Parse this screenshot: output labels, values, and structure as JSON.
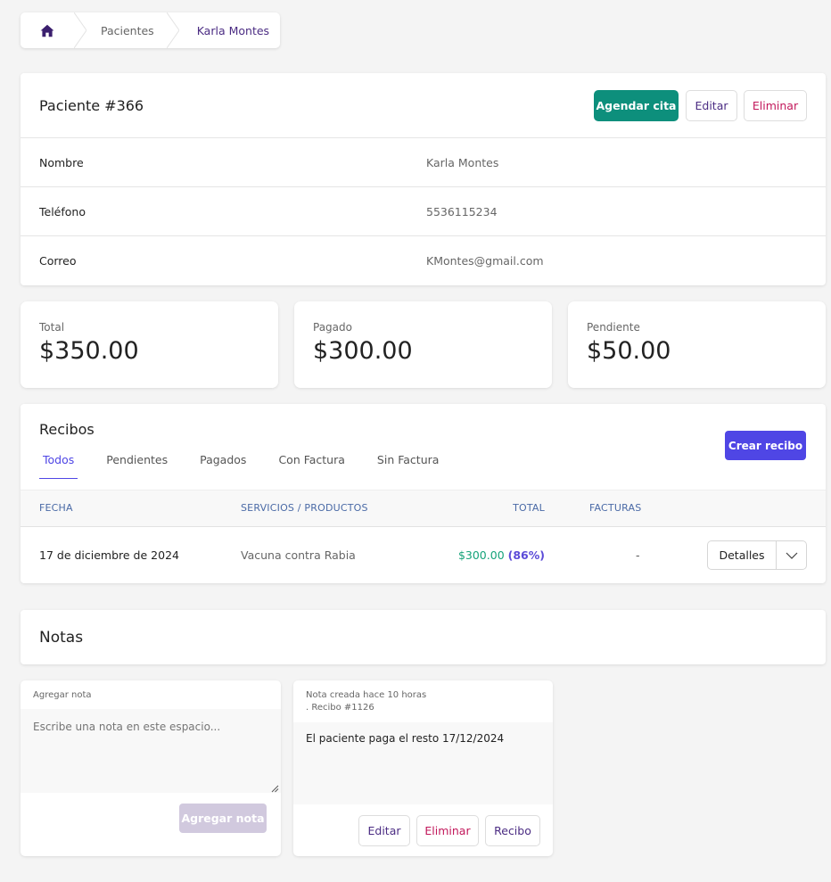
{
  "breadcrumb": {
    "home_icon": "home-icon",
    "items": [
      "Pacientes",
      "Karla Montes"
    ]
  },
  "patient": {
    "title": "Paciente #366",
    "actions": {
      "schedule": "Agendar cita",
      "edit": "Editar",
      "delete": "Eliminar"
    },
    "fields": [
      {
        "label": "Nombre",
        "value": "Karla Montes"
      },
      {
        "label": "Teléfono",
        "value": "5536115234"
      },
      {
        "label": "Correo",
        "value": "KMontes@gmail.com"
      }
    ]
  },
  "totals": [
    {
      "label": "Total",
      "value": "$350.00"
    },
    {
      "label": "Pagado",
      "value": "$300.00"
    },
    {
      "label": "Pendiente",
      "value": "$50.00"
    }
  ],
  "receipts": {
    "title": "Recibos",
    "create_label": "Crear recibo",
    "tabs": [
      {
        "label": "Todos",
        "active": true
      },
      {
        "label": "Pendientes",
        "active": false
      },
      {
        "label": "Pagados",
        "active": false
      },
      {
        "label": "Con Factura",
        "active": false
      },
      {
        "label": "Sin Factura",
        "active": false
      }
    ],
    "columns": {
      "date": "FECHA",
      "services": "SERVICIOS / PRODUCTOS",
      "total": "TOTAL",
      "invoices": "FACTURAS"
    },
    "rows": [
      {
        "date": "17 de diciembre de 2024",
        "services": "Vacuna contra Rabia",
        "total": "$300.00",
        "percent": "(86%)",
        "invoices": "-",
        "details_label": "Detalles"
      }
    ]
  },
  "notes": {
    "title": "Notas",
    "add": {
      "label": "Agregar nota",
      "placeholder": "Escribe una nota en este espacio...",
      "button": "Agregar nota"
    },
    "items": [
      {
        "meta_line1": "Nota creada hace 10 horas",
        "meta_line2": ". Recibo #1126",
        "body": "El paciente paga el resto 17/12/2024",
        "edit": "Editar",
        "delete": "Eliminar",
        "receipt": "Recibo"
      }
    ]
  },
  "colors": {
    "teal": "#0d8f7c",
    "indigo": "#4f46e5",
    "purple": "#4b2c83",
    "danger": "#c2185b",
    "money_green": "#16a37a"
  }
}
